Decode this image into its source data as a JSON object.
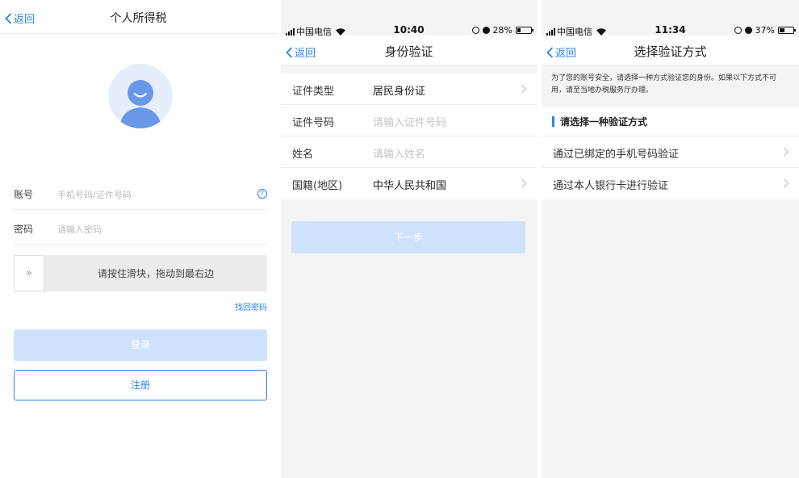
{
  "login": {
    "back_label": "返回",
    "title": "个人所得税",
    "account_label": "账号",
    "account_placeholder": "手机号码/证件号码",
    "password_label": "密码",
    "password_placeholder": "请输入密码",
    "slider_handle": "»",
    "slider_text": "请按住滑块，拖动到最右边",
    "forgot_label": "找回密码",
    "login_label": "登录",
    "register_label": "注册"
  },
  "identity": {
    "status": {
      "carrier": "中国电信",
      "time": "10:40",
      "battery": "28%",
      "battery_level": 0.28
    },
    "back_label": "返回",
    "title": "身份验证",
    "rows": [
      {
        "label": "证件类型",
        "value": "居民身份证",
        "placeholder": false,
        "chevron": true
      },
      {
        "label": "证件号码",
        "value": "请输入证件号码",
        "placeholder": true,
        "chevron": false
      },
      {
        "label": "姓名",
        "value": "请输入姓名",
        "placeholder": true,
        "chevron": false
      },
      {
        "label": "国籍(地区)",
        "value": "中华人民共和国",
        "placeholder": false,
        "chevron": true
      }
    ],
    "next_label": "下一步"
  },
  "verify": {
    "status": {
      "carrier": "中国电信",
      "time": "11:34",
      "battery": "37%",
      "battery_level": 0.37
    },
    "back_label": "返回",
    "title": "选择验证方式",
    "notice": "为了您的账号安全，请选择一种方式验证您的身份。如果以下方式不可用，请至当地办税服务厅办理。",
    "section_title": "请选择一种验证方式",
    "options": [
      {
        "label": "通过已绑定的手机号码验证"
      },
      {
        "label": "通过本人银行卡进行验证"
      }
    ]
  },
  "colors": {
    "accent": "#2b84e6",
    "disabled_button": "#cfe2fb"
  }
}
